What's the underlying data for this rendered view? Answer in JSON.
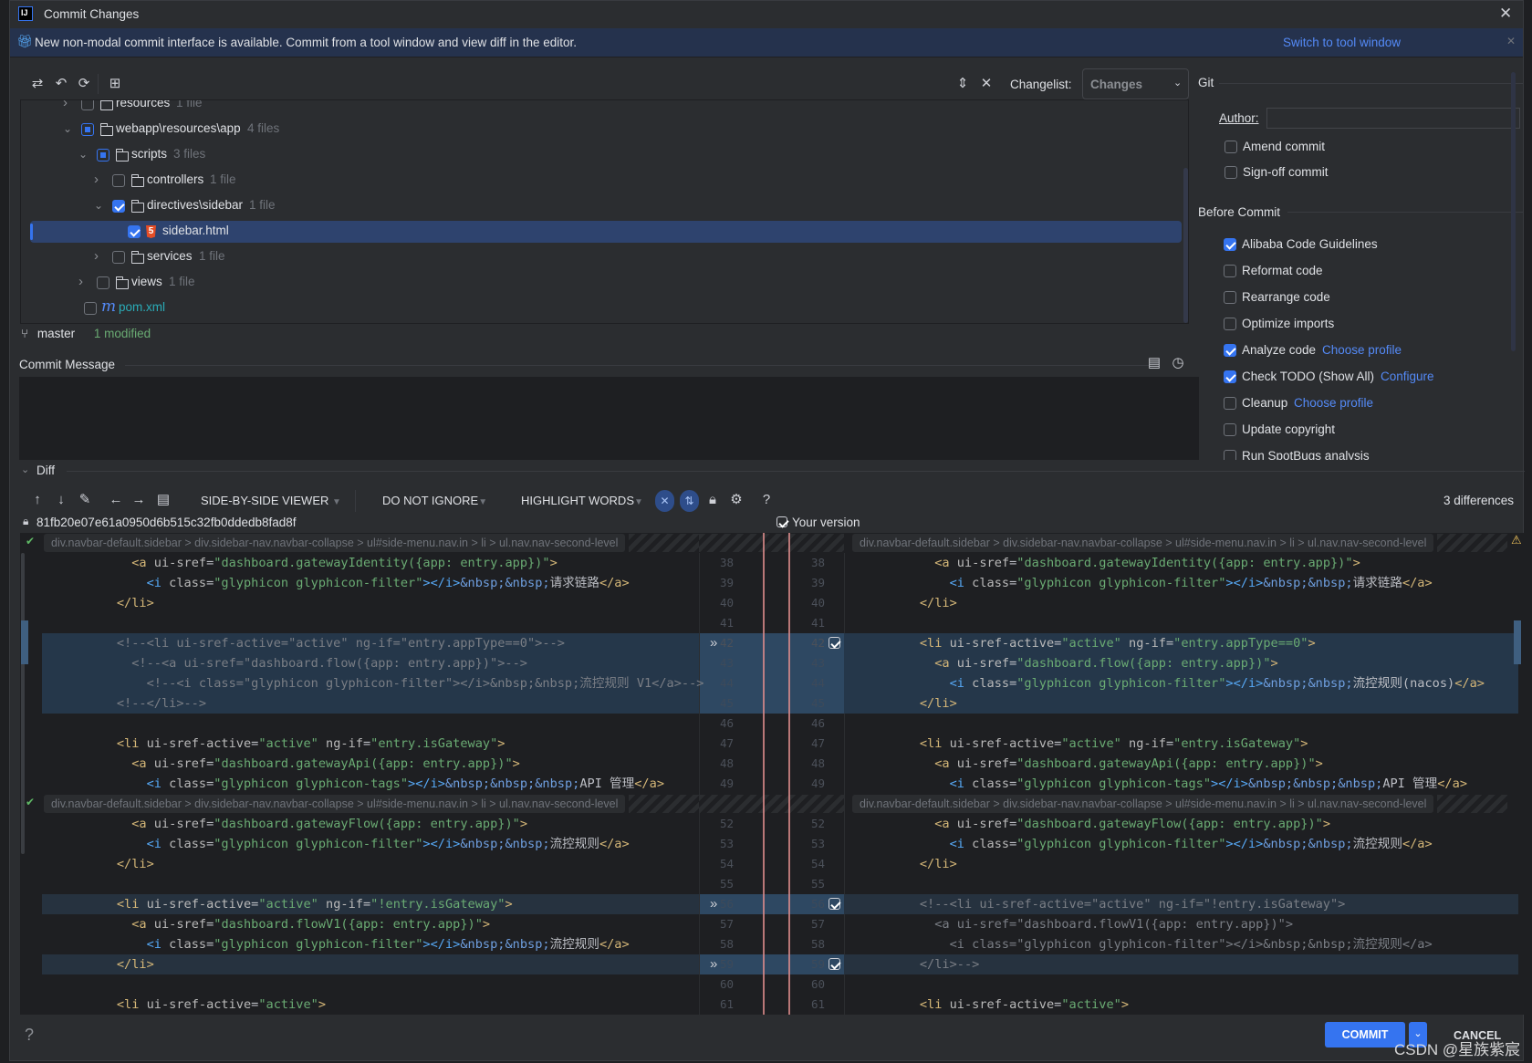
{
  "window": {
    "title": "Commit Changes",
    "app_icon": "intellij-logo-icon"
  },
  "banner": {
    "text": "New non-modal commit interface is available. Commit from a tool window and view diff in the editor.",
    "link": "Switch to tool window",
    "icon": "gift-icon"
  },
  "toolbar": {
    "changelist_label": "Changelist:",
    "changelist_value": "Changes"
  },
  "tree": [
    {
      "name": "resources",
      "count": "1 file",
      "state": "off",
      "icon": "folder",
      "chev": ">"
    },
    {
      "name": "webapp\\resources\\app",
      "count": "4 files",
      "state": "part",
      "icon": "folder",
      "chev": "v"
    },
    {
      "name": "scripts",
      "count": "3 files",
      "state": "part",
      "icon": "folder",
      "chev": "v"
    },
    {
      "name": "controllers",
      "count": "1 file",
      "state": "off",
      "icon": "folder",
      "chev": ">"
    },
    {
      "name": "directives\\sidebar",
      "count": "1 file",
      "state": "on",
      "icon": "folder",
      "chev": "v"
    },
    {
      "name": "sidebar.html",
      "count": "",
      "state": "on",
      "icon": "html5",
      "chev": "",
      "selected": true
    },
    {
      "name": "services",
      "count": "1 file",
      "state": "off",
      "icon": "folder",
      "chev": ">"
    },
    {
      "name": "views",
      "count": "1 file",
      "state": "off",
      "icon": "folder",
      "chev": ">"
    },
    {
      "name": "pom.xml",
      "count": "",
      "state": "off",
      "icon": "maven",
      "chev": ""
    }
  ],
  "status": {
    "branch": "master",
    "modified": "1 modified"
  },
  "commit_message": {
    "label": "Commit Message",
    "value": ""
  },
  "git": {
    "section": "Git",
    "author_label": "Author:",
    "author_value": "",
    "amend": "Amend commit",
    "signoff": "Sign-off commit"
  },
  "before_commit": {
    "section": "Before Commit",
    "items": [
      {
        "label": "Alibaba Code Guidelines",
        "checked": true,
        "link": ""
      },
      {
        "label": "Reformat code",
        "checked": false,
        "link": ""
      },
      {
        "label": "Rearrange code",
        "checked": false,
        "link": ""
      },
      {
        "label": "Optimize imports",
        "checked": false,
        "link": ""
      },
      {
        "label": "Analyze code",
        "checked": true,
        "link": "Choose profile"
      },
      {
        "label": "Check TODO (Show All)",
        "checked": true,
        "link": "Configure"
      },
      {
        "label": "Cleanup",
        "checked": false,
        "link": "Choose profile"
      },
      {
        "label": "Update copyright",
        "checked": false,
        "link": ""
      },
      {
        "label": "Run SpotBugs analysis",
        "checked": false,
        "link": ""
      }
    ]
  },
  "diff": {
    "section": "Diff",
    "viewer": "SIDE-BY-SIDE VIEWER",
    "ignore": "DO NOT IGNORE",
    "highlight": "HIGHLIGHT WORDS",
    "differences": "3 differences",
    "left_revision": "81fb20e07e61a0950d6b515c32fb0ddedb8fad8f",
    "right_revision": "Your version",
    "breadcrumb": "div.navbar-default.sidebar > div.sidebar-nav.navbar-collapse > ul#side-menu.nav.in > li > ul.nav.nav-second-level",
    "rows": [
      {
        "l": "38",
        "r": "38",
        "left": "            <a ui-sref=\"dashboard.gatewayIdentity({app: entry.app})\">",
        "right": "            <a ui-sref=\"dashboard.gatewayIdentity({app: entry.app})\">"
      },
      {
        "l": "39",
        "r": "39",
        "left": "              <i class=\"glyphicon glyphicon-filter\"></i>&nbsp;&nbsp;请求链路</a>",
        "right": "              <i class=\"glyphicon glyphicon-filter\"></i>&nbsp;&nbsp;请求链路</a>"
      },
      {
        "l": "40",
        "r": "40",
        "left": "          </li>",
        "right": "          </li>"
      },
      {
        "l": "41",
        "r": "41",
        "left": "",
        "right": ""
      },
      {
        "l": "42",
        "r": "42",
        "kind": "change",
        "arrow": true,
        "left": "          <!--<li ui-sref-active=\"active\" ng-if=\"entry.appType==0\">-->",
        "lc": true,
        "right": "          <li ui-sref-active=\"active\" ng-if=\"entry.appType==0\">"
      },
      {
        "l": "43",
        "r": "43",
        "kind": "change",
        "faded": true,
        "left": "            <!--<a ui-sref=\"dashboard.flow({app: entry.app})\">-->",
        "lc": true,
        "right": "            <a ui-sref=\"dashboard.flow({app: entry.app})\">"
      },
      {
        "l": "44",
        "r": "44",
        "kind": "change",
        "faded": true,
        "left": "              <!--<i class=\"glyphicon glyphicon-filter\"></i>&nbsp;&nbsp;流控规则 V1</a>-->",
        "lc": true,
        "right": "              <i class=\"glyphicon glyphicon-filter\"></i>&nbsp;&nbsp;流控规则(nacos)</a>"
      },
      {
        "l": "45",
        "r": "45",
        "kind": "change",
        "faded": true,
        "left": "          <!--</li>-->",
        "lc": true,
        "right": "          </li>"
      },
      {
        "l": "46",
        "r": "46",
        "left": "",
        "right": ""
      },
      {
        "l": "47",
        "r": "47",
        "left": "          <li ui-sref-active=\"active\" ng-if=\"entry.isGateway\">",
        "right": "          <li ui-sref-active=\"active\" ng-if=\"entry.isGateway\">"
      },
      {
        "l": "48",
        "r": "48",
        "left": "            <a ui-sref=\"dashboard.gatewayApi({app: entry.app})\">",
        "right": "            <a ui-sref=\"dashboard.gatewayApi({app: entry.app})\">"
      },
      {
        "l": "49",
        "r": "49",
        "left": "              <i class=\"glyphicon glyphicon-tags\"></i>&nbsp;&nbsp;&nbsp;API 管理</a>",
        "right": "              <i class=\"glyphicon glyphicon-tags\"></i>&nbsp;&nbsp;&nbsp;API 管理</a>"
      },
      {
        "kind": "fold"
      },
      {
        "l": "52",
        "r": "52",
        "left": "            <a ui-sref=\"dashboard.gatewayFlow({app: entry.app})\">",
        "right": "            <a ui-sref=\"dashboard.gatewayFlow({app: entry.app})\">"
      },
      {
        "l": "53",
        "r": "53",
        "left": "              <i class=\"glyphicon glyphicon-filter\"></i>&nbsp;&nbsp;流控规则</a>",
        "right": "              <i class=\"glyphicon glyphicon-filter\"></i>&nbsp;&nbsp;流控规则</a>"
      },
      {
        "l": "54",
        "r": "54",
        "left": "          </li>",
        "right": "          </li>"
      },
      {
        "l": "55",
        "r": "55",
        "left": "",
        "right": ""
      },
      {
        "l": "56",
        "r": "56",
        "kind": "change2",
        "arrow": true,
        "faded": true,
        "left": "          <li ui-sref-active=\"active\" ng-if=\"!entry.isGateway\">",
        "right": "          <!--<li ui-sref-active=\"active\" ng-if=\"!entry.isGateway\">",
        "rc": true
      },
      {
        "l": "57",
        "r": "57",
        "left": "            <a ui-sref=\"dashboard.flowV1({app: entry.app})\">",
        "right": "            <a ui-sref=\"dashboard.flowV1({app: entry.app})\">",
        "rc": true
      },
      {
        "l": "58",
        "r": "58",
        "left": "              <i class=\"glyphicon glyphicon-filter\"></i>&nbsp;&nbsp;流控规则</a>",
        "right": "              <i class=\"glyphicon glyphicon-filter\"></i>&nbsp;&nbsp;流控规则</a>",
        "rc": true
      },
      {
        "l": "59",
        "r": "59",
        "kind": "change2",
        "arrow": true,
        "faded": true,
        "left": "          </li>",
        "right": "          </li>-->",
        "rc": true
      },
      {
        "l": "60",
        "r": "60",
        "left": "",
        "right": ""
      },
      {
        "l": "61",
        "r": "61",
        "left": "          <li ui-sref-active=\"active\">",
        "right": "          <li ui-sref-active=\"active\">"
      }
    ]
  },
  "footer": {
    "help": "?",
    "commit": "COMMIT",
    "cancel": "CANCEL",
    "watermark": "CSDN @星族紫宸"
  },
  "colors": {
    "accent": "#3574f0",
    "link": "#548af7",
    "banner": "#25324d",
    "selection": "#2e436e",
    "tag": "#d5b778",
    "string": "#6aab73",
    "entity": "#6f9fe0",
    "comment": "#7a7e85",
    "diff_modified": "#25374a"
  }
}
